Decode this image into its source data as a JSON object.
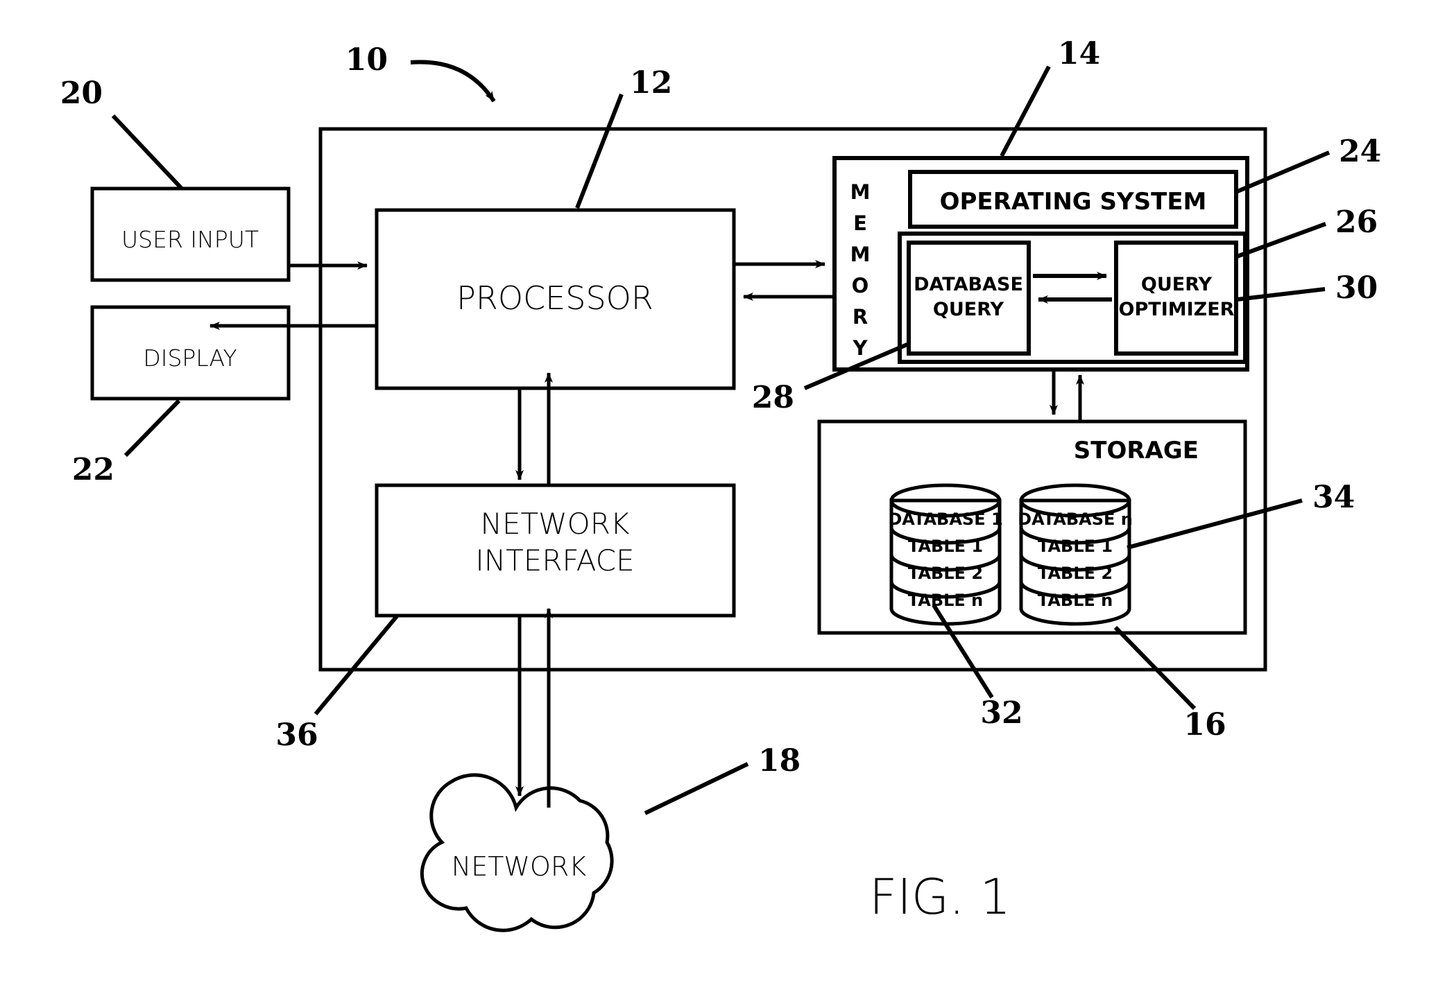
{
  "figure": {
    "caption": "FIG. 1",
    "type": "patent-block-diagram"
  },
  "blocks": {
    "system": {
      "ref": "10"
    },
    "user_input": {
      "label": "USER INPUT",
      "ref": "20"
    },
    "display": {
      "label": "DISPLAY",
      "ref": "22"
    },
    "processor": {
      "label": "PROCESSOR",
      "ref": "12"
    },
    "network_interface": {
      "label_line1": "NETWORK",
      "label_line2": "INTERFACE",
      "ref": "36"
    },
    "memory": {
      "label": "MEMORY",
      "letters": [
        "M",
        "E",
        "M",
        "O",
        "R",
        "Y"
      ],
      "ref": "14"
    },
    "operating_system": {
      "label": "OPERATING SYSTEM",
      "ref": "24"
    },
    "dbms_container": {
      "ref": "26"
    },
    "database_query": {
      "label_line1": "DATABASE",
      "label_line2": "QUERY",
      "ref": "28"
    },
    "query_optimizer": {
      "label_line1": "QUERY",
      "label_line2": "OPTIMIZER",
      "ref": "30"
    },
    "storage": {
      "label": "STORAGE",
      "ref": "16"
    },
    "database_1": {
      "ref": "32",
      "rows": [
        "DATABASE 1",
        "TABLE 1",
        "TABLE 2",
        "TABLE n"
      ]
    },
    "database_n": {
      "ref": "34",
      "rows": [
        "DATABASE n",
        "TABLE 1",
        "TABLE 2",
        "TABLE n"
      ]
    },
    "network": {
      "label": "NETWORK",
      "ref": "18"
    }
  },
  "reference_numerals": [
    {
      "id": "10",
      "target": "system-boundary"
    },
    {
      "id": "12",
      "target": "processor"
    },
    {
      "id": "14",
      "target": "memory"
    },
    {
      "id": "16",
      "target": "storage"
    },
    {
      "id": "18",
      "target": "network-cloud"
    },
    {
      "id": "20",
      "target": "user-input"
    },
    {
      "id": "22",
      "target": "display"
    },
    {
      "id": "24",
      "target": "operating-system"
    },
    {
      "id": "26",
      "target": "dbms-container"
    },
    {
      "id": "28",
      "target": "database-query"
    },
    {
      "id": "30",
      "target": "query-optimizer"
    },
    {
      "id": "32",
      "target": "database-1"
    },
    {
      "id": "34",
      "target": "database-n"
    },
    {
      "id": "36",
      "target": "network-interface"
    }
  ],
  "colors": {
    "ink": "#000000",
    "paper": "#ffffff"
  }
}
